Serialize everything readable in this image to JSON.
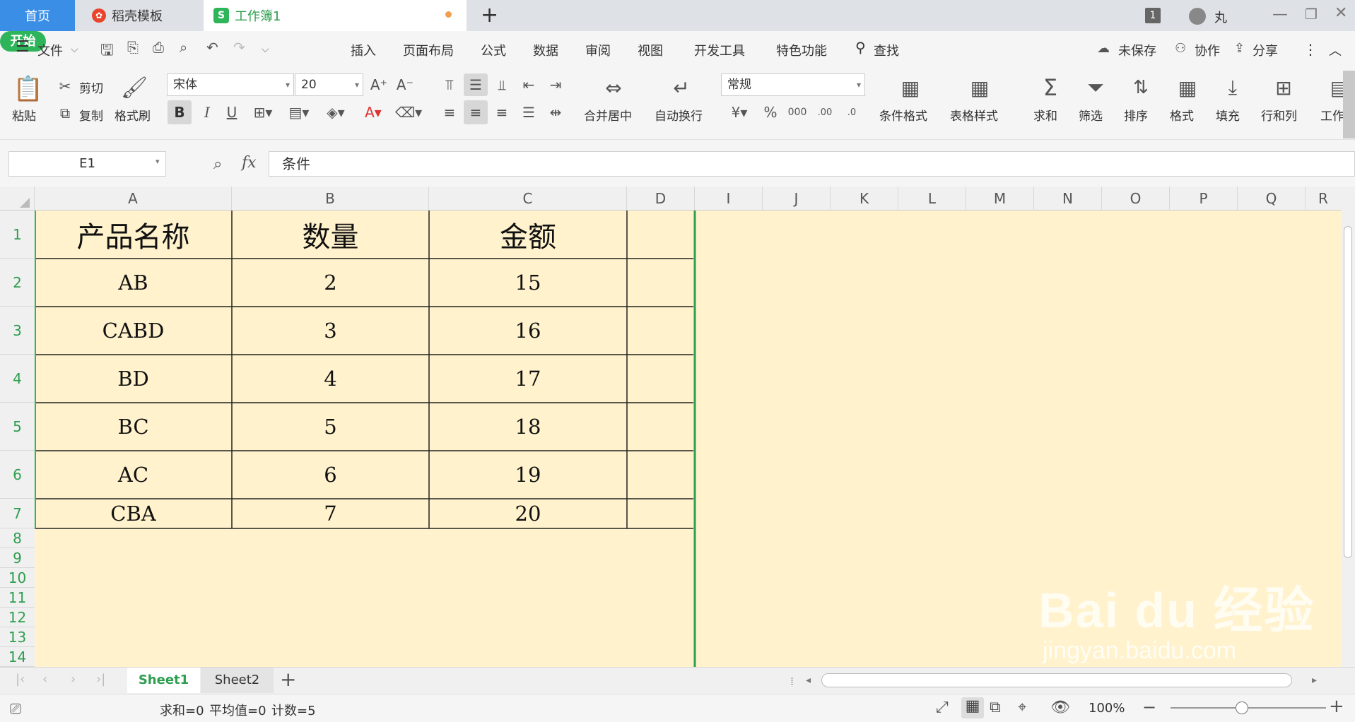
{
  "tabs": {
    "home": "首页",
    "template": "稻壳模板",
    "workbook": "工作簿1",
    "new_tab": "+"
  },
  "titlebar": {
    "window_count": "1",
    "user": "丸"
  },
  "menu": {
    "file": "文件",
    "items": [
      "开始",
      "插入",
      "页面布局",
      "公式",
      "数据",
      "审阅",
      "视图",
      "开发工具",
      "特色功能"
    ],
    "search": "查找",
    "unsaved": "未保存",
    "collab": "协作",
    "share": "分享"
  },
  "ribbon": {
    "paste": "粘贴",
    "cut": "剪切",
    "copy": "复制",
    "format_painter": "格式刷",
    "font_name": "宋体",
    "font_size": "20",
    "merge_center": "合并居中",
    "auto_wrap": "自动换行",
    "number_format": "常规",
    "cond_format": "条件格式",
    "table_style": "表格样式",
    "sum": "求和",
    "filter": "筛选",
    "sort": "排序",
    "format": "格式",
    "fill": "填充",
    "row_col": "行和列",
    "worksheet": "工作"
  },
  "formula_bar": {
    "name_box": "E1",
    "fx": "fx",
    "content": "条件"
  },
  "columns": [
    "A",
    "B",
    "C",
    "D",
    "I",
    "J",
    "K",
    "L",
    "M",
    "N",
    "O",
    "P",
    "Q",
    "R"
  ],
  "rows": [
    "1",
    "2",
    "3",
    "4",
    "5",
    "6",
    "7",
    "8",
    "9",
    "10",
    "11",
    "12",
    "13",
    "14"
  ],
  "table": {
    "headers": [
      "产品名称",
      "数量",
      "金额"
    ],
    "data": [
      [
        "AB",
        "2",
        "15"
      ],
      [
        "CABD",
        "3",
        "16"
      ],
      [
        "BD",
        "4",
        "17"
      ],
      [
        "BC",
        "5",
        "18"
      ],
      [
        "AC",
        "6",
        "19"
      ],
      [
        "CBA",
        "7",
        "20"
      ]
    ]
  },
  "sheets": [
    "Sheet1",
    "Sheet2"
  ],
  "status": {
    "sum": "求和=0",
    "avg": "平均值=0",
    "count": "计数=5",
    "zoom": "100%"
  },
  "watermark": {
    "brand": "Bai du 经验",
    "url": "jingyan.baidu.com"
  },
  "colors": {
    "accent_green": "#2eb55a",
    "home_tab": "#3a8ee6",
    "sheet_fill": "#fff2cc",
    "row_num": "#2e9e4f"
  }
}
